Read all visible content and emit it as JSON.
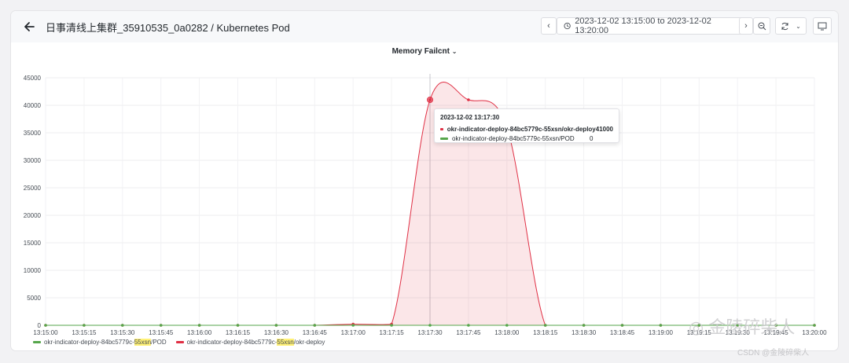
{
  "header": {
    "title": "日事清线上集群_35910535_0a0282 / Kubernetes Pod",
    "time_range": "2023-12-02 13:15:00 to 2023-12-02 13:20:00"
  },
  "panel": {
    "title": "Memory Failcnt"
  },
  "tooltip": {
    "time": "2023-12-02 13:17:30",
    "rows": [
      {
        "name": "okr-indicator-deploy-84bc5779c-55xsn/okr-deploy",
        "value": "41000"
      },
      {
        "name": "okr-indicator-deploy-84bc5779c-55xsn/POD",
        "value": "0"
      }
    ]
  },
  "legend": {
    "items": [
      {
        "prefix": "okr-indicator-deploy-84bc5779c-",
        "highlight": "55xsn",
        "suffix": "/POD"
      },
      {
        "prefix": "okr-indicator-deploy-84bc5779c-",
        "highlight": "55xsn",
        "suffix": "/okr-deploy"
      }
    ]
  },
  "watermark": {
    "main": "金陵碎柴人",
    "csdn": "CSDN @金陵碎柴人"
  },
  "chart_data": {
    "type": "area",
    "x": [
      "13:15:00",
      "13:15:15",
      "13:15:30",
      "13:15:45",
      "13:16:00",
      "13:16:15",
      "13:16:30",
      "13:16:45",
      "13:17:00",
      "13:17:15",
      "13:17:30",
      "13:17:45",
      "13:18:00",
      "13:18:15",
      "13:18:30",
      "13:18:45",
      "13:19:00",
      "13:19:15",
      "13:19:30",
      "13:19:45",
      "13:20:00"
    ],
    "series": [
      {
        "name": "okr-indicator-deploy-84bc5779c-55xsn/POD",
        "color": "#56a64b",
        "values": [
          0,
          0,
          0,
          0,
          0,
          0,
          0,
          0,
          0,
          0,
          0,
          0,
          0,
          0,
          0,
          0,
          0,
          0,
          0,
          0,
          0
        ]
      },
      {
        "name": "okr-indicator-deploy-84bc5779c-55xsn/okr-deploy",
        "color": "#e02f44",
        "values": [
          0,
          0,
          0,
          0,
          0,
          0,
          0,
          0,
          200,
          200,
          41000,
          41000,
          36000,
          0,
          0,
          0,
          0,
          0,
          0,
          0,
          0
        ]
      }
    ],
    "ylim": [
      0,
      45000
    ],
    "yticks": [
      0,
      5000,
      10000,
      15000,
      20000,
      25000,
      30000,
      35000,
      40000,
      45000
    ],
    "grid": true,
    "legend": "bottom-left",
    "hover_index": 10
  }
}
